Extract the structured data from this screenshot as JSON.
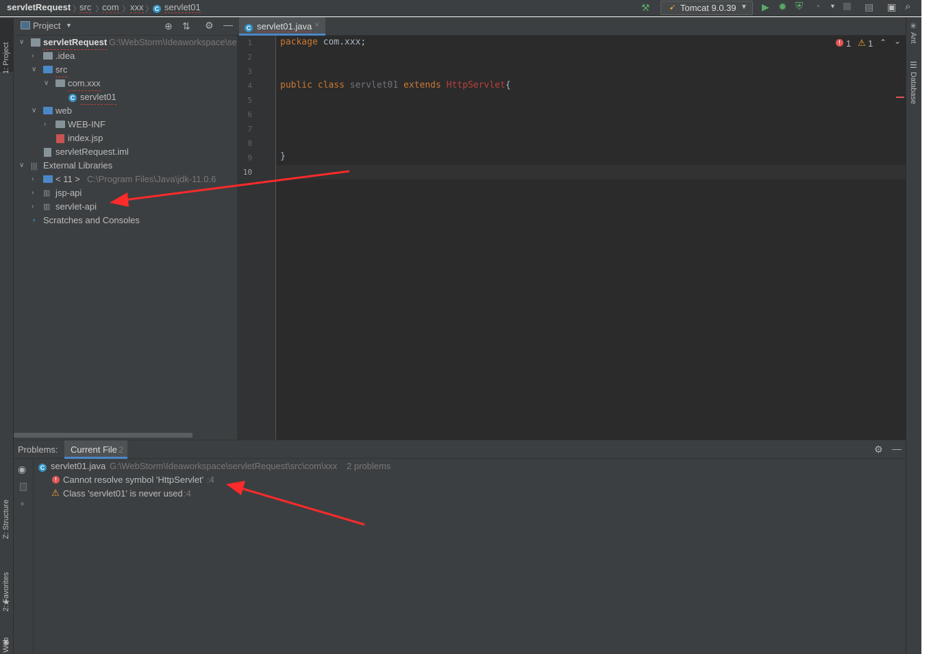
{
  "breadcrumb": {
    "project": "servletRequest",
    "parts": [
      "src",
      "com",
      "xxx"
    ],
    "file": "servlet01"
  },
  "toolbar": {
    "run_config": "Tomcat 9.0.39"
  },
  "project_panel": {
    "title": "Project",
    "tree": {
      "root": "servletRequest",
      "root_path": "G:\\WebStorm\\Ideaworkspace\\se",
      "idea": ".idea",
      "src": "src",
      "package": "com.xxx",
      "class_file": "servlet01",
      "web": "web",
      "web_inf": "WEB-INF",
      "index": "index.jsp",
      "iml": "servletRequest.iml",
      "ext_libs": "External Libraries",
      "jdk_label": "< 11 >",
      "jdk_path": "C:\\Program Files\\Java\\jdk-11.0.6",
      "jsp_api": "jsp-api",
      "servlet_api": "servlet-api",
      "scratches": "Scratches and Consoles"
    }
  },
  "editor": {
    "tab": "servlet01.java",
    "line_numbers": [
      "1",
      "2",
      "3",
      "4",
      "5",
      "6",
      "7",
      "8",
      "9",
      "10"
    ],
    "code": {
      "l1_kw": "package",
      "l1_rest": " com.xxx;",
      "l4_kw1": "public class",
      "l4_name": " servlet01 ",
      "l4_kw2": "extends",
      "l4_sp": " ",
      "l4_super": "HttpServlet",
      "l4_brace": "{",
      "l9": "}"
    },
    "inspection": {
      "errors": "1",
      "warnings": "1"
    }
  },
  "problems": {
    "label": "Problems:",
    "tab": "Current File",
    "tab_count": "2",
    "file": "servlet01.java",
    "path": "G:\\WebStorm\\Ideaworkspace\\servletRequest\\src\\com\\xxx",
    "count_text": "2 problems",
    "items": [
      {
        "text": "Cannot resolve symbol 'HttpServlet'",
        "loc": ":4"
      },
      {
        "text": "Class 'servlet01' is never used",
        "loc": ":4"
      }
    ]
  },
  "side_tabs": {
    "project": "1: Project",
    "structure": "Z: Structure",
    "favorites": "2: Favorites",
    "web": "Web",
    "ant": "Ant",
    "database": "Database"
  },
  "colors": {
    "accent": "#3592c4",
    "error": "#e05555",
    "warning": "#f0a732",
    "annotation_arrow": "#ff2a2a"
  }
}
